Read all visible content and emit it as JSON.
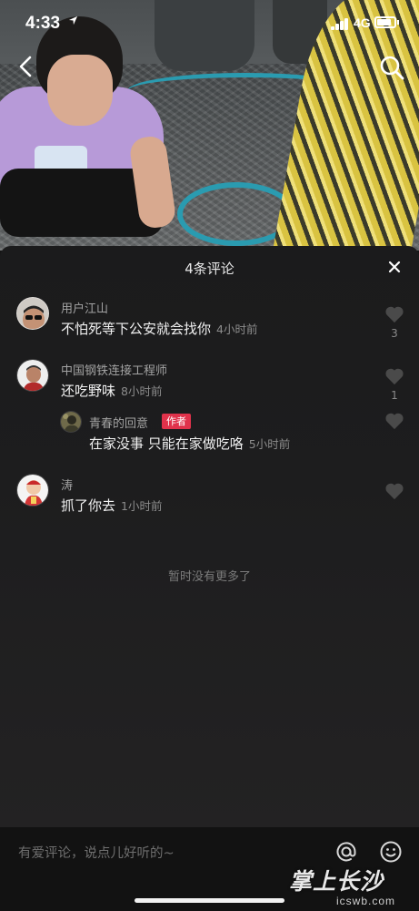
{
  "status_bar": {
    "time": "4:33",
    "location_icon": "location-arrow-icon",
    "network": "4G",
    "signal_icon": "cellular-signal-icon",
    "battery_icon": "battery-icon"
  },
  "video_overlay": {
    "back_icon": "chevron-left-icon",
    "search_icon": "search-icon"
  },
  "comments_panel": {
    "title": "4条评论",
    "close_icon": "close-icon",
    "comments": [
      {
        "username": "用户江山",
        "text": "不怕死等下公安就会找你",
        "time_ago": "4小时前",
        "like_count": "3"
      },
      {
        "username": "中国钢铁连接工程师",
        "text": "还吃野味",
        "time_ago": "8小时前",
        "like_count": "1",
        "replies": [
          {
            "username": "青春的回意",
            "badge": "作者",
            "text": "在家没事 只能在家做吃咯",
            "time_ago": "5小时前"
          }
        ]
      },
      {
        "username": "涛",
        "text": "抓了你去",
        "time_ago": "1小时前"
      }
    ],
    "end_message": "暂时没有更多了"
  },
  "input_bar": {
    "placeholder": "有爱评论，说点儿好听的~",
    "at_icon": "at-icon",
    "emoji_icon": "emoji-icon"
  },
  "watermark": {
    "logo_text": "掌上长沙",
    "url": "icswb.com"
  },
  "colors": {
    "sheet_background": "#1c1c1d",
    "author_badge": "#e0324b",
    "secondary_text": "#a3a3a3"
  }
}
